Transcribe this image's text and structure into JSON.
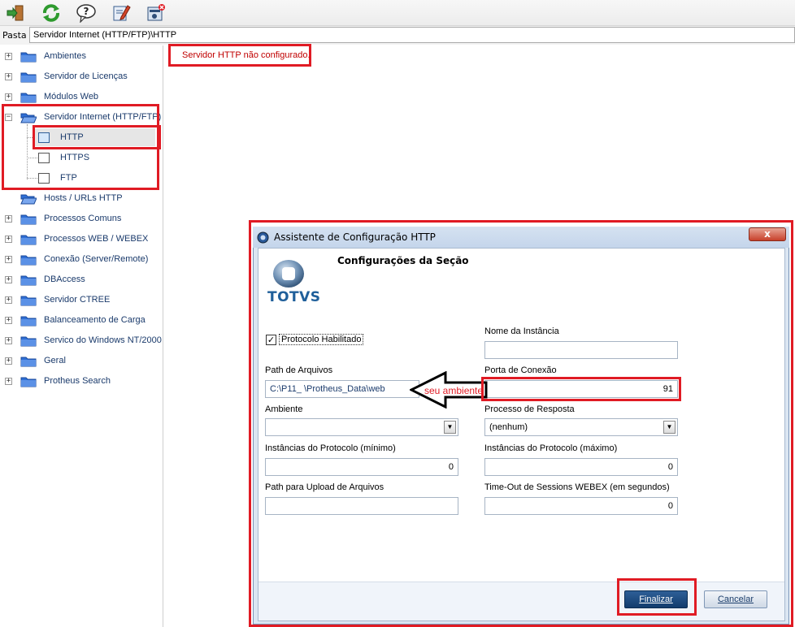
{
  "path_bar": {
    "label": "Pasta",
    "value": "Servidor Internet (HTTP/FTP)\\HTTP"
  },
  "toolbar": {
    "icons": [
      "exit-icon",
      "refresh-icon",
      "help-icon",
      "edit-icon",
      "config-icon"
    ]
  },
  "tree": {
    "items": [
      {
        "label": "Ambientes"
      },
      {
        "label": "Servidor de Licenças"
      },
      {
        "label": "Módulos Web"
      },
      {
        "label": "Servidor Internet (HTTP/FTP)"
      },
      {
        "label": "Hosts / URLs HTTP"
      },
      {
        "label": "Processos Comuns"
      },
      {
        "label": "Processos WEB / WEBEX"
      },
      {
        "label": "Conexão (Server/Remote)"
      },
      {
        "label": "DBAccess"
      },
      {
        "label": "Servidor CTREE"
      },
      {
        "label": "Balanceamento de Carga"
      },
      {
        "label": "Servico do Windows NT/2000"
      },
      {
        "label": "Geral"
      },
      {
        "label": "Protheus Search"
      }
    ],
    "children": [
      {
        "label": "HTTP"
      },
      {
        "label": "HTTPS"
      },
      {
        "label": "FTP"
      }
    ]
  },
  "main": {
    "error_message": "Servidor HTTP não configurado."
  },
  "dialog": {
    "title": "Assistente de Configuração  HTTP",
    "close_label": "x",
    "section_title": "Configurações da Seção",
    "logo_text": "TOTVS",
    "checkbox_label": "Protocolo Habilitado",
    "checkbox_checked": true,
    "fields": {
      "path_arquivos": {
        "label": "Path de Arquivos",
        "value": "C:\\P11_          \\Protheus_Data\\web"
      },
      "ambiente": {
        "label": "Ambiente",
        "value": ""
      },
      "inst_min": {
        "label": "Instâncias do Protocolo (mínimo)",
        "value": "0"
      },
      "upload": {
        "label": "Path para Upload de Arquivos",
        "value": ""
      },
      "nome_instancia": {
        "label": "Nome da Instância",
        "value": ""
      },
      "porta": {
        "label": "Porta de Conexão",
        "value": "91"
      },
      "processo": {
        "label": "Processo de Resposta",
        "value": "(nenhum)"
      },
      "inst_max": {
        "label": "Instâncias do Protocolo (máximo)",
        "value": "0"
      },
      "timeout": {
        "label": "Time-Out de Sessions WEBEX (em segundos)",
        "value": "0"
      }
    },
    "annotation": "seu ambiente",
    "buttons": {
      "finalizar": "Finalizar",
      "cancelar": "Cancelar"
    }
  },
  "colors": {
    "highlight": "#e01b24",
    "tree_text": "#1a3a6b",
    "error_text": "#c00000",
    "primary_button": "#1e4a80"
  }
}
